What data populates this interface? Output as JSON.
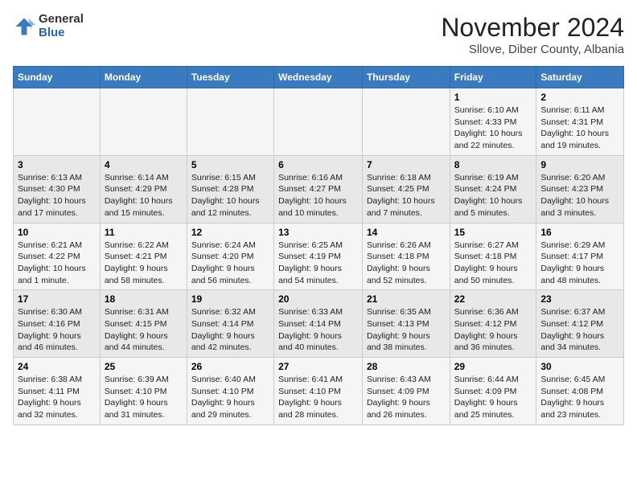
{
  "logo": {
    "general": "General",
    "blue": "Blue"
  },
  "header": {
    "month": "November 2024",
    "location": "Sllove, Diber County, Albania"
  },
  "weekdays": [
    "Sunday",
    "Monday",
    "Tuesday",
    "Wednesday",
    "Thursday",
    "Friday",
    "Saturday"
  ],
  "weeks": [
    [
      {
        "day": "",
        "sunrise": "",
        "sunset": "",
        "daylight": ""
      },
      {
        "day": "",
        "sunrise": "",
        "sunset": "",
        "daylight": ""
      },
      {
        "day": "",
        "sunrise": "",
        "sunset": "",
        "daylight": ""
      },
      {
        "day": "",
        "sunrise": "",
        "sunset": "",
        "daylight": ""
      },
      {
        "day": "",
        "sunrise": "",
        "sunset": "",
        "daylight": ""
      },
      {
        "day": "1",
        "sunrise": "Sunrise: 6:10 AM",
        "sunset": "Sunset: 4:33 PM",
        "daylight": "Daylight: 10 hours and 22 minutes."
      },
      {
        "day": "2",
        "sunrise": "Sunrise: 6:11 AM",
        "sunset": "Sunset: 4:31 PM",
        "daylight": "Daylight: 10 hours and 19 minutes."
      }
    ],
    [
      {
        "day": "3",
        "sunrise": "Sunrise: 6:13 AM",
        "sunset": "Sunset: 4:30 PM",
        "daylight": "Daylight: 10 hours and 17 minutes."
      },
      {
        "day": "4",
        "sunrise": "Sunrise: 6:14 AM",
        "sunset": "Sunset: 4:29 PM",
        "daylight": "Daylight: 10 hours and 15 minutes."
      },
      {
        "day": "5",
        "sunrise": "Sunrise: 6:15 AM",
        "sunset": "Sunset: 4:28 PM",
        "daylight": "Daylight: 10 hours and 12 minutes."
      },
      {
        "day": "6",
        "sunrise": "Sunrise: 6:16 AM",
        "sunset": "Sunset: 4:27 PM",
        "daylight": "Daylight: 10 hours and 10 minutes."
      },
      {
        "day": "7",
        "sunrise": "Sunrise: 6:18 AM",
        "sunset": "Sunset: 4:25 PM",
        "daylight": "Daylight: 10 hours and 7 minutes."
      },
      {
        "day": "8",
        "sunrise": "Sunrise: 6:19 AM",
        "sunset": "Sunset: 4:24 PM",
        "daylight": "Daylight: 10 hours and 5 minutes."
      },
      {
        "day": "9",
        "sunrise": "Sunrise: 6:20 AM",
        "sunset": "Sunset: 4:23 PM",
        "daylight": "Daylight: 10 hours and 3 minutes."
      }
    ],
    [
      {
        "day": "10",
        "sunrise": "Sunrise: 6:21 AM",
        "sunset": "Sunset: 4:22 PM",
        "daylight": "Daylight: 10 hours and 1 minute."
      },
      {
        "day": "11",
        "sunrise": "Sunrise: 6:22 AM",
        "sunset": "Sunset: 4:21 PM",
        "daylight": "Daylight: 9 hours and 58 minutes."
      },
      {
        "day": "12",
        "sunrise": "Sunrise: 6:24 AM",
        "sunset": "Sunset: 4:20 PM",
        "daylight": "Daylight: 9 hours and 56 minutes."
      },
      {
        "day": "13",
        "sunrise": "Sunrise: 6:25 AM",
        "sunset": "Sunset: 4:19 PM",
        "daylight": "Daylight: 9 hours and 54 minutes."
      },
      {
        "day": "14",
        "sunrise": "Sunrise: 6:26 AM",
        "sunset": "Sunset: 4:18 PM",
        "daylight": "Daylight: 9 hours and 52 minutes."
      },
      {
        "day": "15",
        "sunrise": "Sunrise: 6:27 AM",
        "sunset": "Sunset: 4:18 PM",
        "daylight": "Daylight: 9 hours and 50 minutes."
      },
      {
        "day": "16",
        "sunrise": "Sunrise: 6:29 AM",
        "sunset": "Sunset: 4:17 PM",
        "daylight": "Daylight: 9 hours and 48 minutes."
      }
    ],
    [
      {
        "day": "17",
        "sunrise": "Sunrise: 6:30 AM",
        "sunset": "Sunset: 4:16 PM",
        "daylight": "Daylight: 9 hours and 46 minutes."
      },
      {
        "day": "18",
        "sunrise": "Sunrise: 6:31 AM",
        "sunset": "Sunset: 4:15 PM",
        "daylight": "Daylight: 9 hours and 44 minutes."
      },
      {
        "day": "19",
        "sunrise": "Sunrise: 6:32 AM",
        "sunset": "Sunset: 4:14 PM",
        "daylight": "Daylight: 9 hours and 42 minutes."
      },
      {
        "day": "20",
        "sunrise": "Sunrise: 6:33 AM",
        "sunset": "Sunset: 4:14 PM",
        "daylight": "Daylight: 9 hours and 40 minutes."
      },
      {
        "day": "21",
        "sunrise": "Sunrise: 6:35 AM",
        "sunset": "Sunset: 4:13 PM",
        "daylight": "Daylight: 9 hours and 38 minutes."
      },
      {
        "day": "22",
        "sunrise": "Sunrise: 6:36 AM",
        "sunset": "Sunset: 4:12 PM",
        "daylight": "Daylight: 9 hours and 36 minutes."
      },
      {
        "day": "23",
        "sunrise": "Sunrise: 6:37 AM",
        "sunset": "Sunset: 4:12 PM",
        "daylight": "Daylight: 9 hours and 34 minutes."
      }
    ],
    [
      {
        "day": "24",
        "sunrise": "Sunrise: 6:38 AM",
        "sunset": "Sunset: 4:11 PM",
        "daylight": "Daylight: 9 hours and 32 minutes."
      },
      {
        "day": "25",
        "sunrise": "Sunrise: 6:39 AM",
        "sunset": "Sunset: 4:10 PM",
        "daylight": "Daylight: 9 hours and 31 minutes."
      },
      {
        "day": "26",
        "sunrise": "Sunrise: 6:40 AM",
        "sunset": "Sunset: 4:10 PM",
        "daylight": "Daylight: 9 hours and 29 minutes."
      },
      {
        "day": "27",
        "sunrise": "Sunrise: 6:41 AM",
        "sunset": "Sunset: 4:10 PM",
        "daylight": "Daylight: 9 hours and 28 minutes."
      },
      {
        "day": "28",
        "sunrise": "Sunrise: 6:43 AM",
        "sunset": "Sunset: 4:09 PM",
        "daylight": "Daylight: 9 hours and 26 minutes."
      },
      {
        "day": "29",
        "sunrise": "Sunrise: 6:44 AM",
        "sunset": "Sunset: 4:09 PM",
        "daylight": "Daylight: 9 hours and 25 minutes."
      },
      {
        "day": "30",
        "sunrise": "Sunrise: 6:45 AM",
        "sunset": "Sunset: 4:08 PM",
        "daylight": "Daylight: 9 hours and 23 minutes."
      }
    ]
  ]
}
